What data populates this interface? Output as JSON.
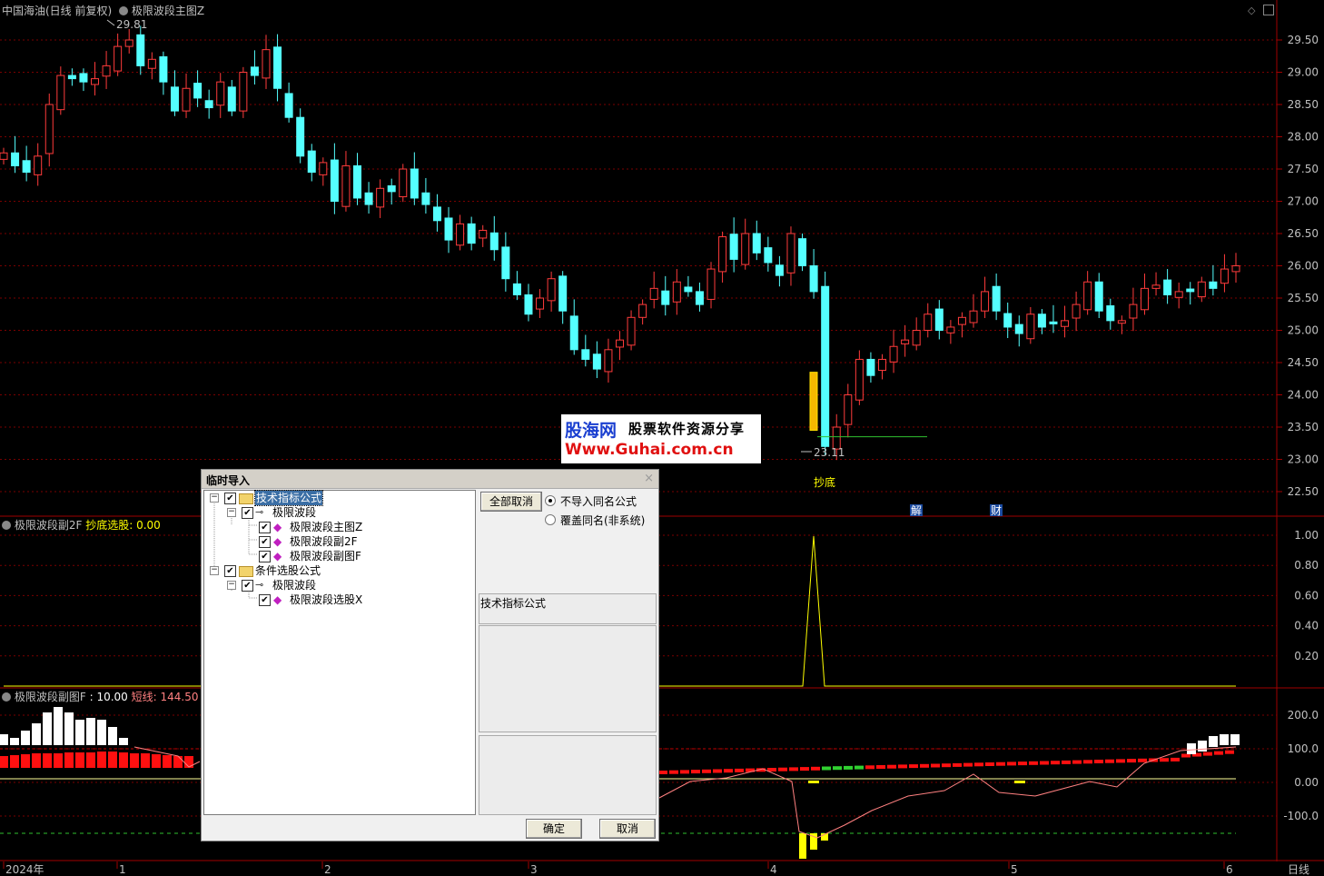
{
  "header": {
    "symbol": "中国海油(日线 前复权)",
    "main_formula": "极限波段主图Z"
  },
  "sub1": {
    "name": "极限波段副2F",
    "label": "抄底选股:",
    "value": "0.00"
  },
  "sub2": {
    "name": "极限波段副图F",
    "label1": ":",
    "value1": "10.00",
    "label2": "短线:",
    "value2": "144.50"
  },
  "price_axis": [
    "29.50",
    "29.00",
    "28.50",
    "28.00",
    "27.50",
    "27.00",
    "26.50",
    "26.00",
    "25.50",
    "25.00",
    "24.50",
    "24.00",
    "23.50",
    "23.00",
    "22.50"
  ],
  "sub1_axis": [
    "1.00",
    "0.80",
    "0.60",
    "0.40",
    "0.20"
  ],
  "sub2_axis": [
    "200.0",
    "100.0",
    "0.00",
    "-100.0"
  ],
  "x_labels": [
    "2024年",
    "1",
    "2",
    "3",
    "4",
    "5",
    "6"
  ],
  "period_label": "日线",
  "annotations": {
    "high": "29.81",
    "low": "23.11",
    "signal": "抄底",
    "jie": "解",
    "cai": "财"
  },
  "watermark": {
    "line1": "股海网",
    "line2": "股票软件资源分享",
    "url": "Www.Guhai.com.cn"
  },
  "dialog": {
    "title": "临时导入",
    "close": "×",
    "tree": [
      {
        "label": "技术指标公式"
      },
      {
        "label": "极限波段"
      },
      {
        "label": "极限波段主图Z"
      },
      {
        "label": "极限波段副2F"
      },
      {
        "label": "极限波段副图F"
      },
      {
        "label": "条件选股公式"
      },
      {
        "label": "极限波段"
      },
      {
        "label": "极限波段选股X"
      }
    ],
    "cancel_all": "全部取消",
    "radio1": "不导入同名公式",
    "radio2": "覆盖同名(非系统)",
    "category": "技术指标公式",
    "ok": "确定",
    "cancel": "取消"
  },
  "colors": {
    "up": "#ff3b3b",
    "down": "#54ffff",
    "yellow": "#ffff00",
    "grid": "#7a0000",
    "bg": "#000000"
  }
}
